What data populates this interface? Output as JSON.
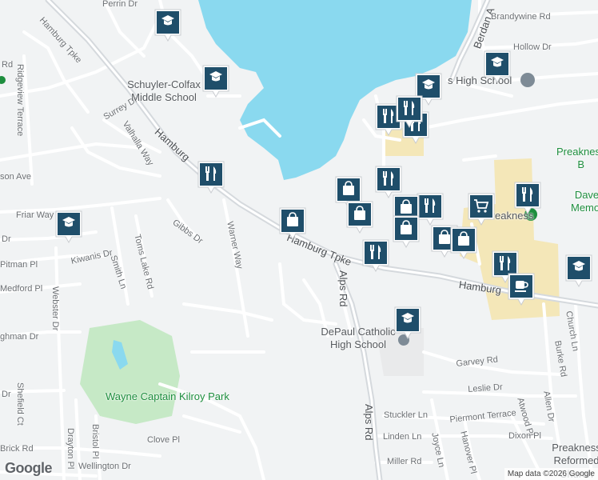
{
  "map": {
    "water_color": "#8ad9ef",
    "park_color": "#c6e9c6",
    "campus_color": "#f4e7b8",
    "road_color": "#ffffff",
    "arterial_color": "#d5d9dd",
    "marker_color": "#1f4e6a"
  },
  "labels": {
    "hamburg_tpke_nw": "Hamburg Tpke",
    "hamburg_mid_1": "Hamburg",
    "hamburg_tpke_center": "Hamburg Tpke",
    "hamburg_east": "Hamburg",
    "alps_rd_north": "Alps Rd",
    "alps_rd_south": "Alps Rd",
    "berdan_ave": "Berdan A",
    "brandywine_rd": "Brandywine Rd",
    "hollow_dr": "Hollow Dr",
    "perrin_dr": "Perrin Dr",
    "ridgeview_terrace": "Ridgeview Terrace",
    "surrey_dr": "Surrey Dr",
    "valhalla_way": "Valhalla Way",
    "son_ave": "son Ave",
    "friar_way": "Friar Way",
    "dr_left": "Dr",
    "pitman_pl": "Pitman Pl",
    "kiwanis_dr": "Kiwanis Dr",
    "medford_pl": "Medford Pl",
    "ghman_dr": "ghman Dr",
    "webster_dr": "Webster Dr",
    "smith_ln": "Smith Ln",
    "toms_lake_rd": "Toms Lake Rd",
    "gibbs_dr": "Gibbs Dr",
    "warner_way": "Warner Way",
    "church_ln": "Church Ln",
    "burke_rd": "Burke Rd",
    "allen_dr": "Allen Dr",
    "atwood_pl": "Atwood Pl",
    "garvey_rd": "Garvey Rd",
    "leslie_dr": "Leslie Dr",
    "stuckler_ln": "Stuckler Ln",
    "piermont_terrace": "Piermont Terrace",
    "linden_ln": "Linden Ln",
    "dixon_pl": "Dixon Pl",
    "joyce_ln": "Joyce Ln",
    "hanover_pl": "Hanover Pl",
    "miller_rd": "Miller Rd",
    "drayton_pl": "Drayton Pl",
    "bristol_pl": "Bristol Pl",
    "clove_pl": "Clove Pl",
    "brick_rd": "Brick Rd",
    "wellington_dr": "Wellington Dr",
    "sheffield_ct": "Shefield Ct",
    "dr_west": "Dr",
    "rd_top": "Rd",
    "schuyler_colfax": "Schuyler-Colfax Middle School",
    "high_school_ne": "s High School",
    "depaul": "DePaul Catholic High School",
    "preakness_sc": "Preakness",
    "preakness_b": "Preakness B",
    "dave_memor": "Dave Memor",
    "wayne_park": "Wayne Captain Kilroy Park",
    "preakness_church": "Preakness Reformed Church",
    "google": "Google",
    "attribution": "Map data ©2026 Google"
  },
  "markers": [
    {
      "type": "school"
    },
    {
      "type": "school"
    },
    {
      "type": "school"
    },
    {
      "type": "school"
    },
    {
      "type": "school"
    },
    {
      "type": "school"
    },
    {
      "type": "school"
    },
    {
      "type": "restaurant"
    },
    {
      "type": "restaurant"
    },
    {
      "type": "restaurant"
    },
    {
      "type": "restaurant"
    },
    {
      "type": "restaurant"
    },
    {
      "type": "restaurant"
    },
    {
      "type": "restaurant"
    },
    {
      "type": "restaurant"
    },
    {
      "type": "restaurant"
    },
    {
      "type": "shopping"
    },
    {
      "type": "shopping"
    },
    {
      "type": "shopping"
    },
    {
      "type": "shopping"
    },
    {
      "type": "shopping"
    },
    {
      "type": "shopping"
    },
    {
      "type": "shopping"
    },
    {
      "type": "grocery"
    },
    {
      "type": "cafe"
    }
  ]
}
